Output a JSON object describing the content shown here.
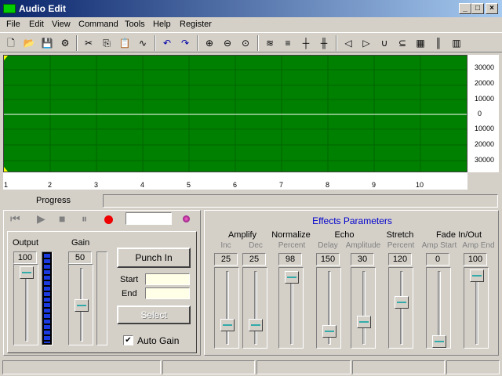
{
  "window": {
    "title": "Audio Edit",
    "min": "_",
    "max": "□",
    "close": "×"
  },
  "menu": [
    "File",
    "Edit",
    "View",
    "Command",
    "Tools",
    "Help",
    "Register"
  ],
  "toolbar": [
    "new-icon",
    "open-icon",
    "save-icon",
    "properties-icon",
    "cut-icon",
    "copy-icon",
    "paste-icon",
    "special-icon",
    "undo-icon",
    "redo-icon",
    "zoom-in-icon",
    "zoom-out-icon",
    "zoom-fit-icon",
    "waveform-icon",
    "compress-icon",
    "marker-icon",
    "expand-icon",
    "fade-left-icon",
    "fade-right-icon",
    "loop-icon",
    "reverse-icon",
    "equalizer-icon",
    "levels-icon",
    "bars-icon"
  ],
  "waveform": {
    "bg": "#008000",
    "y_ticks": [
      "30000",
      "20000",
      "10000",
      "0",
      "10000",
      "20000",
      "30000"
    ],
    "x_ticks": [
      "1",
      "2",
      "3",
      "4",
      "5",
      "6",
      "7",
      "8",
      "9",
      "10"
    ]
  },
  "progress": {
    "label": "Progress",
    "value": 0
  },
  "transport": {
    "time_value": ""
  },
  "output": {
    "label": "Output",
    "value": "100",
    "level": 1.0
  },
  "gain": {
    "label": "Gain",
    "value": "50",
    "level": 0.5
  },
  "punch": {
    "button": "Punch In",
    "start_label": "Start",
    "end_label": "End",
    "start_value": "",
    "end_value": "",
    "select_button": "Select",
    "auto_gain_label": "Auto Gain",
    "auto_gain_checked": "✔"
  },
  "effects": {
    "title": "Effects Parameters",
    "groups": [
      {
        "name": "Amplify",
        "subs": [
          "Inc",
          "Dec"
        ],
        "values": [
          "25",
          "25"
        ],
        "levels": [
          0.25,
          0.25
        ]
      },
      {
        "name": "Normalize",
        "subs": [
          "Percent"
        ],
        "values": [
          "98"
        ],
        "levels": [
          0.98
        ]
      },
      {
        "name": "Echo",
        "subs": [
          "Delay",
          "Amplitude"
        ],
        "values": [
          "150",
          "30"
        ],
        "levels": [
          0.15,
          0.3
        ]
      },
      {
        "name": "Stretch",
        "subs": [
          "Percent"
        ],
        "values": [
          "120"
        ],
        "levels": [
          0.6
        ]
      },
      {
        "name": "Fade In/Out",
        "subs": [
          "Amp Start",
          "Amp End"
        ],
        "values": [
          "0",
          "100"
        ],
        "levels": [
          0,
          1.0
        ]
      }
    ]
  }
}
